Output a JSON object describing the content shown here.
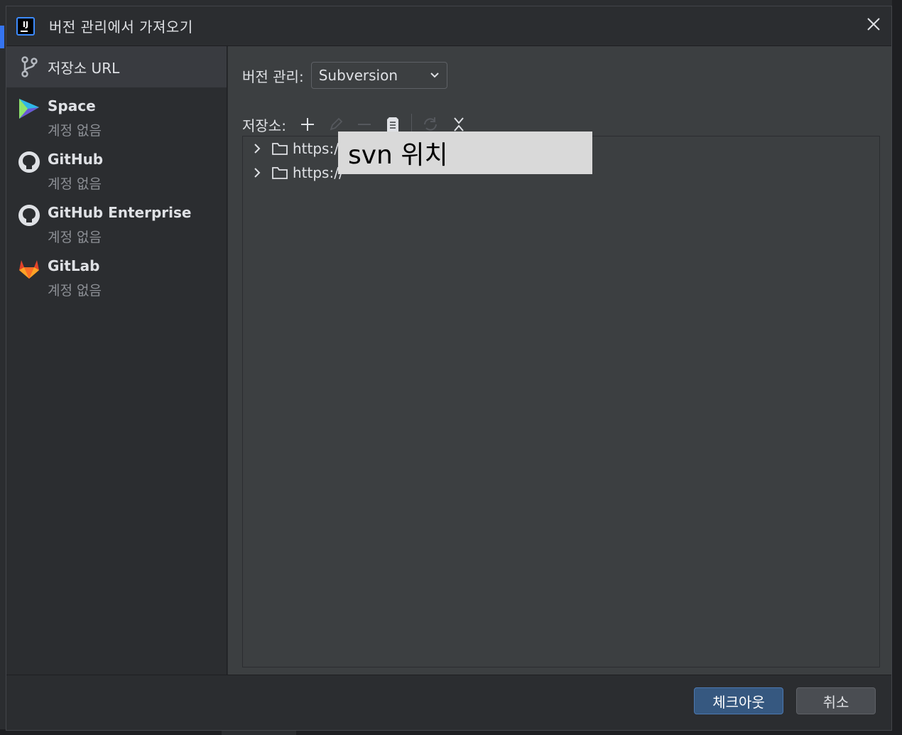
{
  "dialog": {
    "title": "버전 관리에서 가져오기",
    "app_icon_text": "IJ"
  },
  "sidebar": {
    "items": [
      {
        "label": "저장소 URL",
        "sub": "",
        "icon": "git-branch-icon",
        "selected": true
      },
      {
        "label": "Space",
        "sub": "계정 없음",
        "icon": "space-icon"
      },
      {
        "label": "GitHub",
        "sub": "계정 없음",
        "icon": "github-icon"
      },
      {
        "label": "GitHub Enterprise",
        "sub": "계정 없음",
        "icon": "github-icon"
      },
      {
        "label": "GitLab",
        "sub": "계정 없음",
        "icon": "gitlab-icon"
      }
    ]
  },
  "vcs": {
    "label": "버전 관리:",
    "selected": "Subversion"
  },
  "repositories": {
    "label": "저장소:",
    "toolbar": [
      "add-icon",
      "edit-icon",
      "remove-icon",
      "browse-icon",
      "refresh-icon",
      "collapse-icon"
    ],
    "items": [
      {
        "url": "https://"
      },
      {
        "url": "https://"
      }
    ]
  },
  "overlay": {
    "text": "svn 위치"
  },
  "footer": {
    "checkout_label": "체크아웃",
    "cancel_label": "취소"
  },
  "colors": {
    "accent": "#3574f0",
    "primary_button": "#365880",
    "dialog_bg": "#2b2d30",
    "content_bg": "#3c3f41"
  }
}
